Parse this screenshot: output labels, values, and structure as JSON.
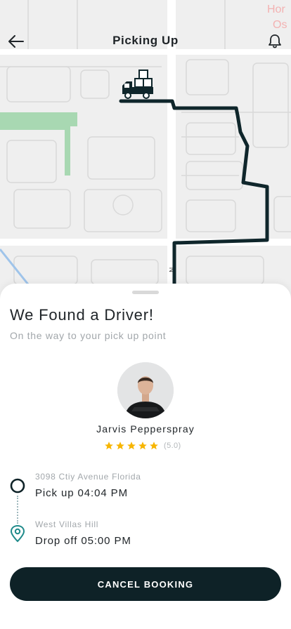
{
  "header": {
    "title": "Picking Up",
    "back_icon": "arrow-left-icon",
    "bell_icon": "bell-icon"
  },
  "map": {
    "corner_label_1": "Hor",
    "corner_label_2": "Os",
    "street_label": "N",
    "route_color": "#0f262b",
    "vehicle_icon": "delivery-truck-icon"
  },
  "sheet": {
    "heading": "We Found a Driver!",
    "subheading": "On the way to your pick up point"
  },
  "driver": {
    "name": "Jarvis Pepperspray",
    "rating": "(5.0)",
    "stars": 5,
    "star_color": "#f7b500"
  },
  "route": {
    "pickup_address": "3098 Ctiy Avenue Florida",
    "pickup_time": "Pick up 04:04 PM",
    "dropoff_address": "West Villas Hill",
    "dropoff_time": "Drop off 05:00 PM",
    "pickup_icon": "circle-outline-icon",
    "dropoff_icon": "location-pin-icon",
    "dropoff_color": "#1f8a8a"
  },
  "actions": {
    "cancel_label": "CANCEL BOOKING"
  },
  "colors": {
    "primary_dark": "#0e2227",
    "accent_teal": "#1f8a8a"
  }
}
